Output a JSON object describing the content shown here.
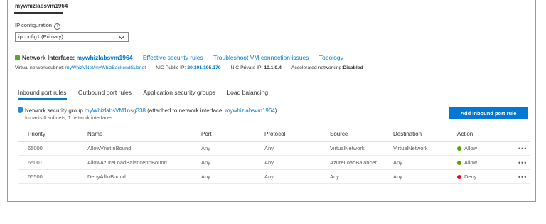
{
  "header": {
    "title": "mywhizlabsvm1964"
  },
  "ip_config": {
    "label": "IP configuration",
    "info_glyph": "i",
    "selected": "ipconfig1 (Primary)"
  },
  "nic": {
    "prefix": "Network Interface:",
    "name": "mywhizlabsvm1964",
    "links": [
      "Effective security rules",
      "Troubleshoot VM connection issues",
      "Topology"
    ]
  },
  "meta": {
    "vnet_label": "Virtual network/subnet:",
    "vnet_value": "myWhizVNet/myWhizBackendSubnet",
    "public_ip_label": "NIC Public IP:",
    "public_ip_value": "20.101.195.170",
    "private_ip_label": "NIC Private IP:",
    "private_ip_value": "10.1.0.4",
    "accel_label": "Accelerated networking:",
    "accel_value": "Disabled"
  },
  "tabs": [
    "Inbound port rules",
    "Outbound port rules",
    "Application security groups",
    "Load balancing"
  ],
  "nsg": {
    "prefix": "Network security group",
    "name": "myWhizlabsVM1nsg338",
    "attached_prefix": "(attached to network interface:",
    "attached_nic": "mywhizlabsvm1964",
    "attached_suffix": ")",
    "impacts": "Impacts 0 subnets, 1 network interfaces"
  },
  "add_button": "Add inbound port rule",
  "columns": [
    "Priority",
    "Name",
    "Port",
    "Protocol",
    "Source",
    "Destination",
    "Action"
  ],
  "rules": [
    {
      "priority": "65000",
      "name": "AllowVnetInBound",
      "port": "Any",
      "protocol": "Any",
      "source": "VirtualNetwork",
      "destination": "VirtualNetwork",
      "action": "Allow",
      "more": "•••"
    },
    {
      "priority": "65001",
      "name": "AllowAzureLoadBalancerInBound",
      "port": "Any",
      "protocol": "Any",
      "source": "AzureLoadBalancer",
      "destination": "Any",
      "action": "Allow",
      "more": "•••"
    },
    {
      "priority": "65500",
      "name": "DenyAllInBound",
      "port": "Any",
      "protocol": "Any",
      "source": "Any",
      "destination": "Any",
      "action": "Deny",
      "more": "•••"
    }
  ],
  "colors": {
    "accent": "#0078d4",
    "allow": "#57a300",
    "deny": "#e00b1c"
  }
}
